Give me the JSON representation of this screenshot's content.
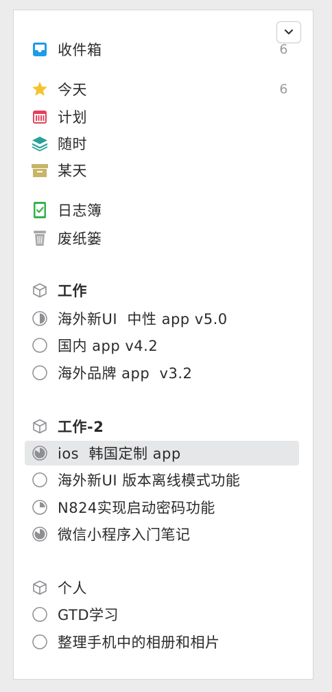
{
  "sidebar": {
    "inbox": {
      "label": "收件箱",
      "count": "6"
    },
    "today": {
      "label": "今天",
      "count": "6"
    },
    "upcoming": {
      "label": "计划"
    },
    "anytime": {
      "label": "随时"
    },
    "someday": {
      "label": "某天"
    },
    "logbook": {
      "label": "日志簿"
    },
    "trash": {
      "label": "废纸篓"
    },
    "areas": [
      {
        "label": "工作",
        "projects": [
          {
            "label": "海外新UI  中性 app v5.0",
            "progress": 0.5
          },
          {
            "label": "国内 app v4.2",
            "progress": 0
          },
          {
            "label": "海外品牌 app  v3.2",
            "progress": 0
          }
        ]
      },
      {
        "label": "工作-2",
        "projects": [
          {
            "label": "ios  韩国定制 app",
            "progress": 0.85,
            "selected": true
          },
          {
            "label": "海外新UI 版本离线模式功能",
            "progress": 0
          },
          {
            "label": "N824实现启动密码功能",
            "progress": 0.25
          },
          {
            "label": "微信小程序入门笔记",
            "progress": 0.85
          }
        ]
      },
      {
        "label": "个人",
        "projects": [
          {
            "label": "GTD学习",
            "progress": 0
          },
          {
            "label": "整理手机中的相册和相片",
            "progress": 0
          }
        ]
      }
    ]
  },
  "colors": {
    "inbox": "#1e9be9",
    "today": "#f5c32c",
    "upcoming": "#e5405e",
    "anytime": "#2aa198",
    "someday": "#c7b466",
    "logbook": "#34b24a",
    "trash": "#a9a9a9",
    "progress": "#8e8e93"
  }
}
